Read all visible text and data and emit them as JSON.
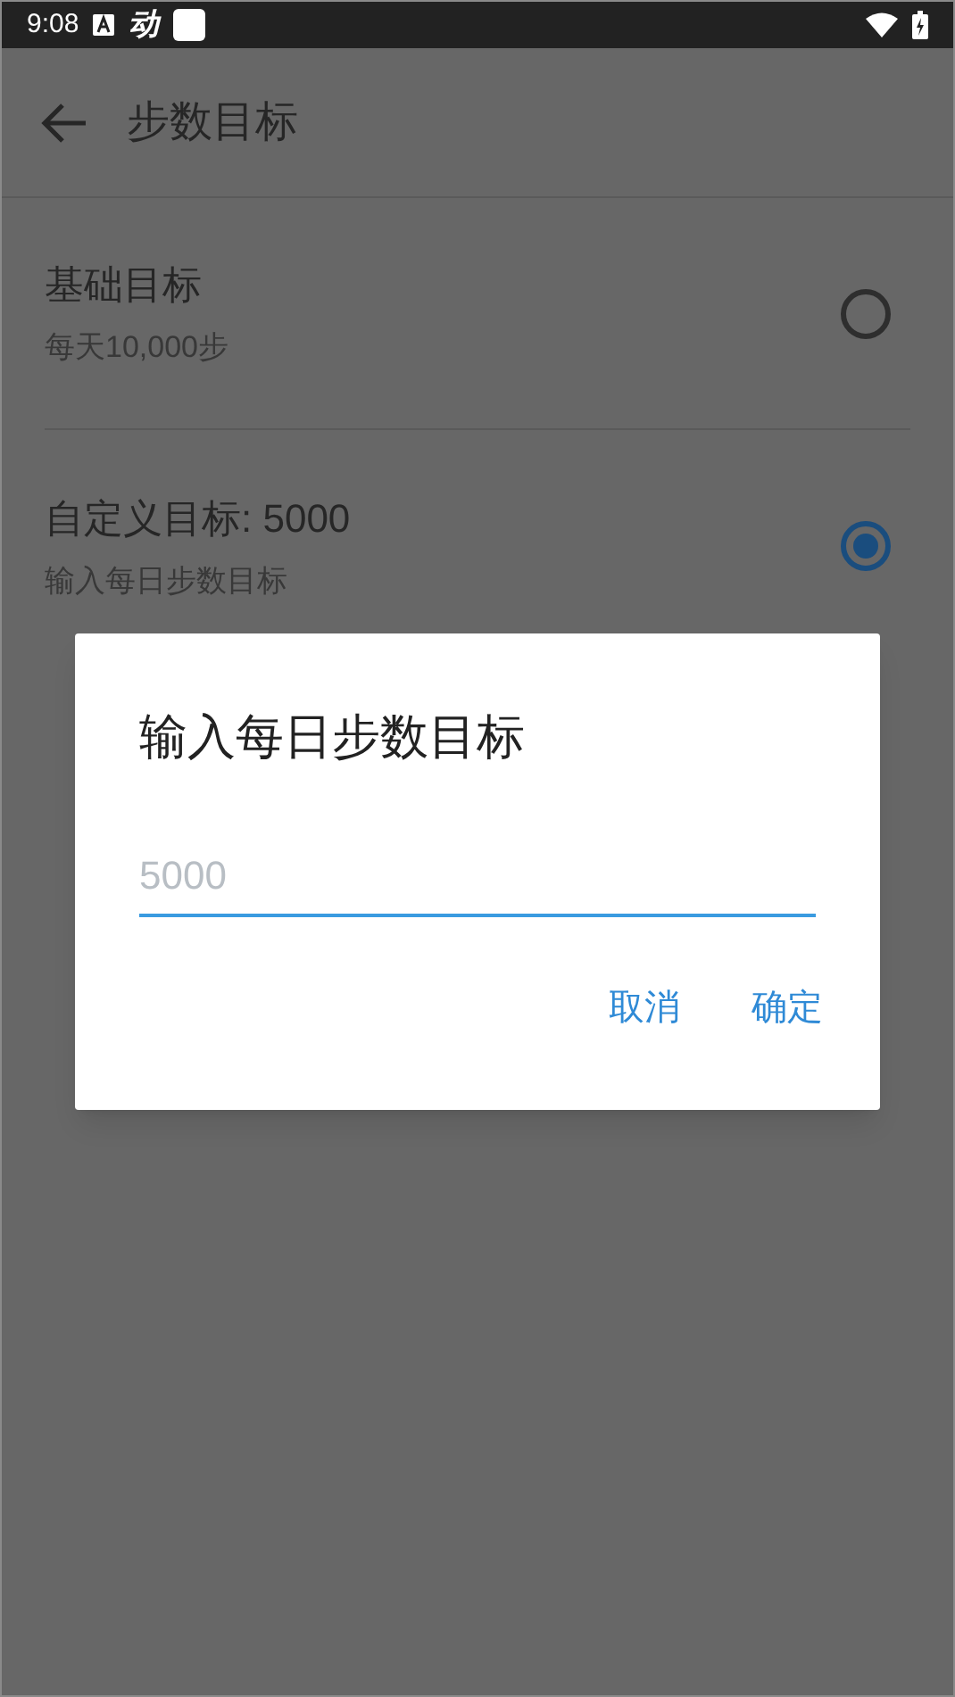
{
  "status_bar": {
    "time": "9:08",
    "notification_glyph": "动"
  },
  "app_bar": {
    "title": "步数目标"
  },
  "options": [
    {
      "title": "基础目标",
      "subtitle": "每天10,000步",
      "selected": false
    },
    {
      "title": "自定义目标: 5000",
      "subtitle": "输入每日步数目标",
      "selected": true
    }
  ],
  "dialog": {
    "title": "输入每日步数目标",
    "field": {
      "placeholder": "5000"
    },
    "buttons": [
      "取消",
      "确定"
    ]
  }
}
